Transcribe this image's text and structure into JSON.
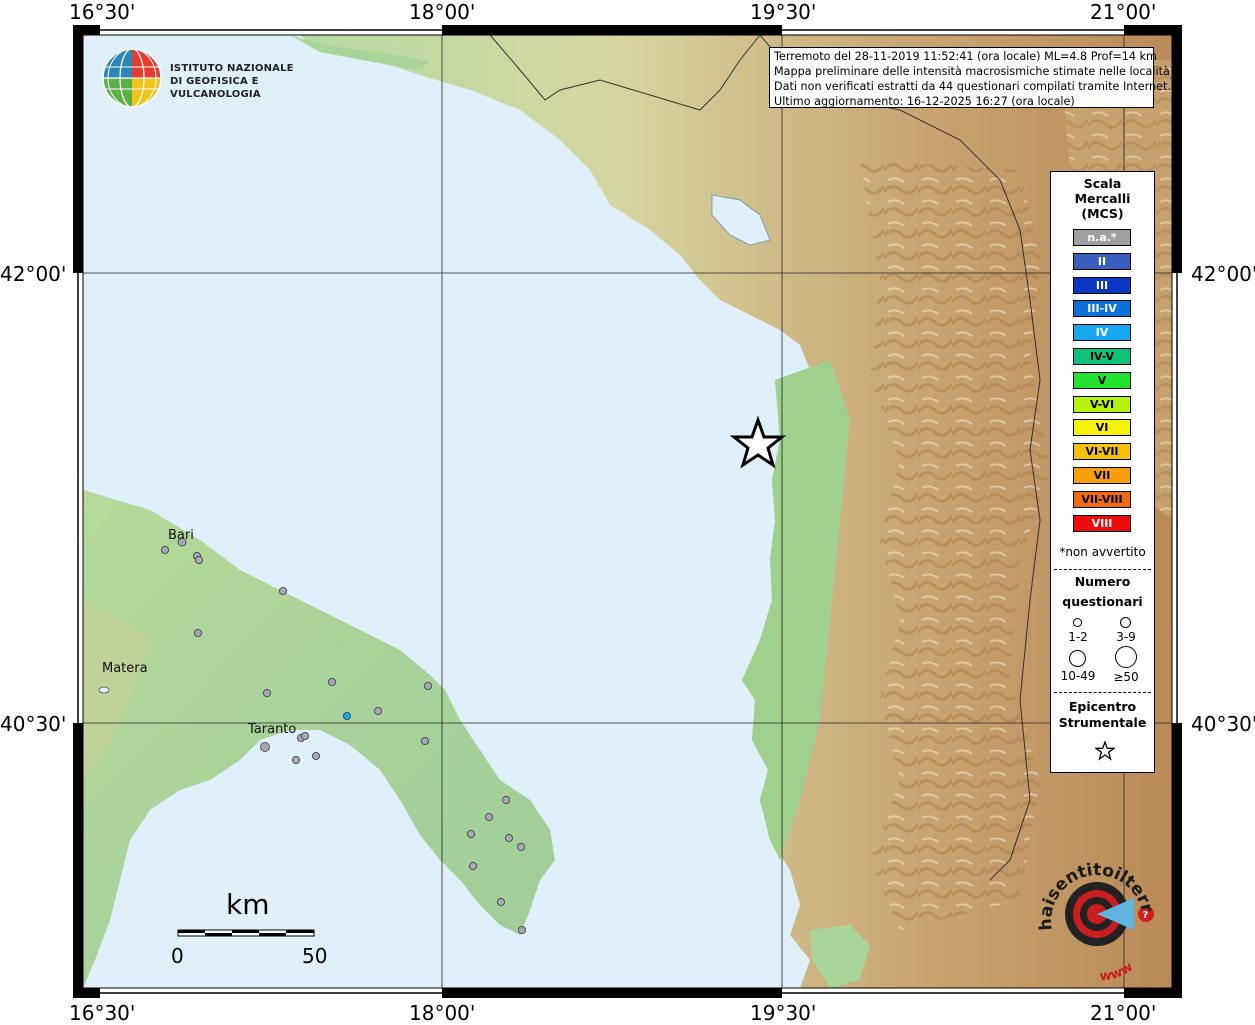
{
  "ticks": {
    "top": [
      "16°30'",
      "18°00'",
      "19°30'",
      "21°00'"
    ],
    "bottom": [
      "16°30'",
      "18°00'",
      "19°30'",
      "21°00'"
    ],
    "left": [
      "42°00'",
      "40°30'"
    ],
    "right": [
      "42°00'",
      "40°30'"
    ]
  },
  "info": {
    "line1": "Terremoto del 28-11-2019 11:52:41 (ora locale) ML=4.8 Prof=14 km",
    "line2": "Mappa preliminare delle intensità macrosismiche stimate nelle località",
    "line3": "Dati non verificati estratti da 44 questionari compilati tramite Internet.",
    "line4": "Ultimo aggiornamento: 16-12-2025 16:27 (ora locale)"
  },
  "logo": {
    "line1": "ISTITUTO NAZIONALE",
    "line2": "DI GEOFISICA E VULCANOLOGIA"
  },
  "legend": {
    "title1": "Scala",
    "title2": "Mercalli",
    "title3": "(MCS)",
    "scale": [
      {
        "label": "n.a.*",
        "color": "#a0a0a0",
        "text": "#ffffff"
      },
      {
        "label": "II",
        "color": "#3a5fbf",
        "text": "#ffffff"
      },
      {
        "label": "III",
        "color": "#0c37c4",
        "text": "#ffffff"
      },
      {
        "label": "III-IV",
        "color": "#0a73d9",
        "text": "#ffffff"
      },
      {
        "label": "IV",
        "color": "#17a7ef",
        "text": "#ffffff"
      },
      {
        "label": "IV-V",
        "color": "#0fc27a",
        "text": "#000000"
      },
      {
        "label": "V",
        "color": "#22e32d",
        "text": "#000000"
      },
      {
        "label": "V-VI",
        "color": "#b5f20e",
        "text": "#000000"
      },
      {
        "label": "VI",
        "color": "#f7f20c",
        "text": "#000000"
      },
      {
        "label": "VI-VII",
        "color": "#f7c00d",
        "text": "#000000"
      },
      {
        "label": "VII",
        "color": "#f79e0d",
        "text": "#000000"
      },
      {
        "label": "VII-VIII",
        "color": "#f06a10",
        "text": "#000000"
      },
      {
        "label": "VIII",
        "color": "#ee0b0b",
        "text": "#ffffff"
      }
    ],
    "not_felt_note": "*non avvertito",
    "count_title1": "Numero",
    "count_title2": "questionari",
    "count_labels": [
      "1-2",
      "3-9",
      "10-49",
      "≥50"
    ],
    "epicenter_title1": "Epicentro",
    "epicenter_title2": "Strumentale"
  },
  "cities": {
    "bari": "Bari",
    "matera": "Matera",
    "taranto": "Taranto"
  },
  "scalebar": {
    "unit": "km",
    "start": "0",
    "end": "50"
  },
  "watermark": {
    "text": "haisentitoilterremoto.it",
    "url": "www"
  },
  "colors": {
    "sea": "#dff0fb",
    "land": "#a9d49a",
    "highland": "#d7c48f",
    "mountain": "#b98e5a",
    "report_dot": "#a7a7b5",
    "report_dot_iv": "#17a7ef"
  }
}
